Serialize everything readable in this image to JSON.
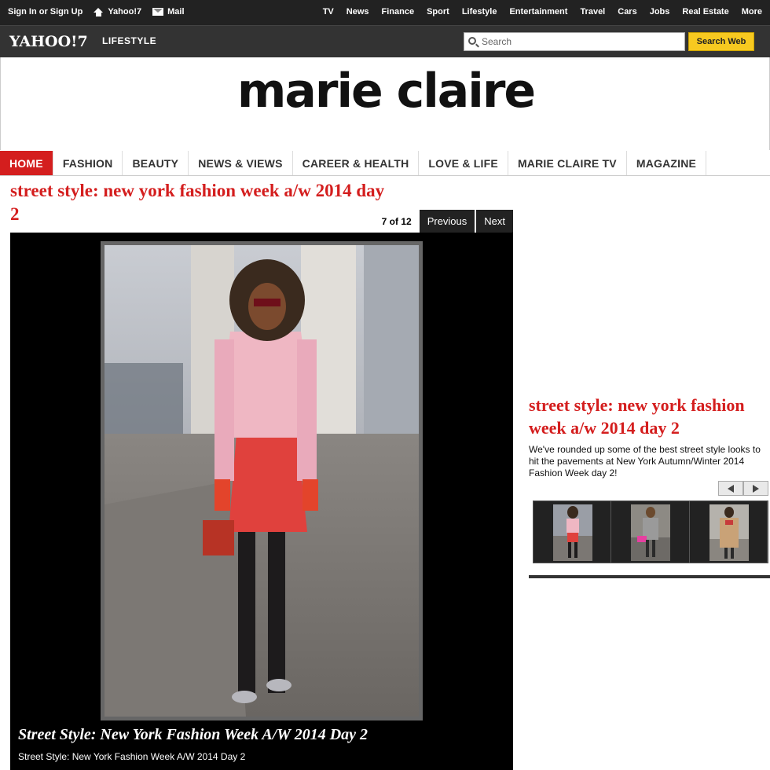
{
  "topbar": {
    "sign_in": "Sign In or Sign Up",
    "yahoo7": "Yahoo!7",
    "mail": "Mail",
    "links": [
      "TV",
      "News",
      "Finance",
      "Sport",
      "Lifestyle",
      "Entertainment",
      "Travel",
      "Cars",
      "Jobs",
      "Real Estate",
      "More"
    ]
  },
  "yahoobar": {
    "logo": "YAHOO!7",
    "section": "LIFESTYLE",
    "search_placeholder": "Search",
    "search_button": "Search Web"
  },
  "masthead": {
    "title": "marie claire"
  },
  "nav": {
    "items": [
      "HOME",
      "FASHION",
      "BEAUTY",
      "NEWS & VIEWS",
      "CAREER & HEALTH",
      "LOVE & LIFE",
      "MARIE CLAIRE TV",
      "MAGAZINE"
    ]
  },
  "article": {
    "title": "street style: new york fashion week a/w 2014 day 2",
    "counter": "7 of 12",
    "prev_label": "Previous",
    "next_label": "Next",
    "caption_title": "Street Style: New York Fashion Week A/W 2014 Day 2",
    "caption_sub": "Street Style: New York Fashion Week A/W 2014 Day 2"
  },
  "sidebar": {
    "title": "street style: new york fashion week a/w 2014 day 2",
    "description": "We've rounded up some of the best street style looks to hit the pavements at New York Autumn/Winter 2014 Fashion Week day 2!"
  },
  "colors": {
    "brand_red": "#d41e1e",
    "search_yellow": "#f7c920",
    "topbar_bg": "#222222"
  },
  "icons": [
    "home-icon",
    "mail-icon",
    "search-icon",
    "arrow-left-icon",
    "arrow-right-icon"
  ]
}
